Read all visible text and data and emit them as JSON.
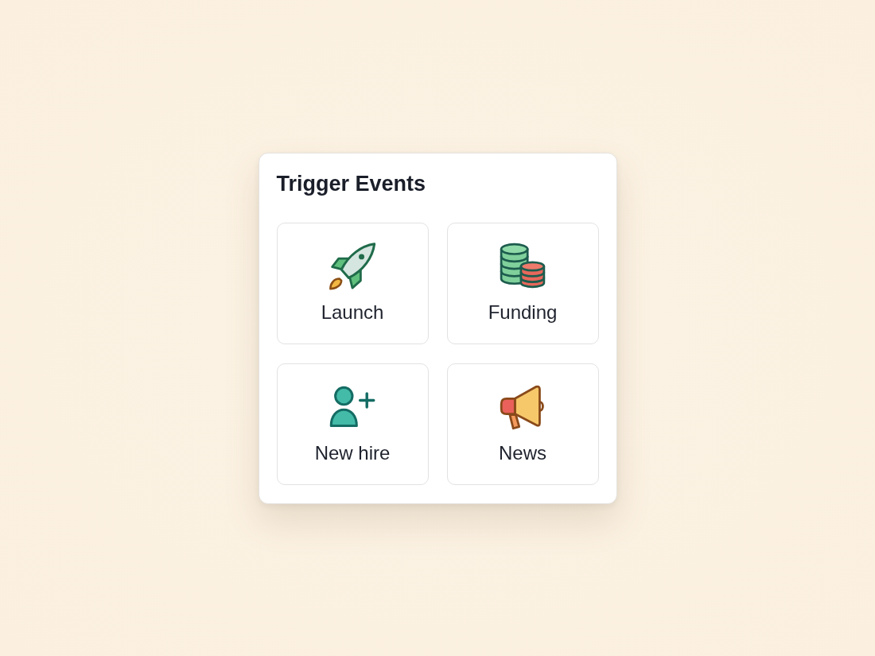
{
  "panel": {
    "title": "Trigger Events",
    "events": [
      {
        "kind": "launch",
        "label": "Launch"
      },
      {
        "kind": "funding",
        "label": "Funding"
      },
      {
        "kind": "hire",
        "label": "New hire"
      },
      {
        "kind": "news",
        "label": "News"
      }
    ]
  }
}
